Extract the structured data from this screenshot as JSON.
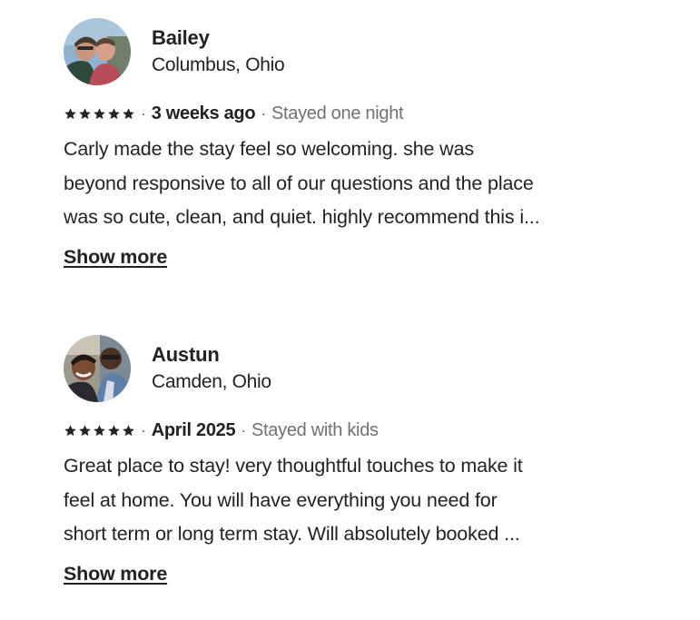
{
  "reviews": [
    {
      "name": "Bailey",
      "location": "Columbus, Ohio",
      "rating": 5,
      "date": "3 weeks ago",
      "stay": "Stayed one night",
      "text_lines": [
        "Carly made the stay feel  so welcoming.  she was",
        "beyond responsive to all of our questions and the place",
        "was  so cute, clean, and quiet. highly recommend this i..."
      ],
      "show_more": "Show more"
    },
    {
      "name": "Austun",
      "location": "Camden, Ohio",
      "rating": 5,
      "date": "April 2025",
      "stay": "Stayed with kids",
      "text_lines": [
        "Great place to stay! very thoughtful touches to make it",
        "feel at home. You will have everything you need for",
        "short term or long term stay. Will absolutely booked ..."
      ],
      "show_more": "Show more"
    }
  ],
  "separator": "·",
  "colors": {
    "text_primary": "#222222",
    "text_secondary": "#717171"
  }
}
